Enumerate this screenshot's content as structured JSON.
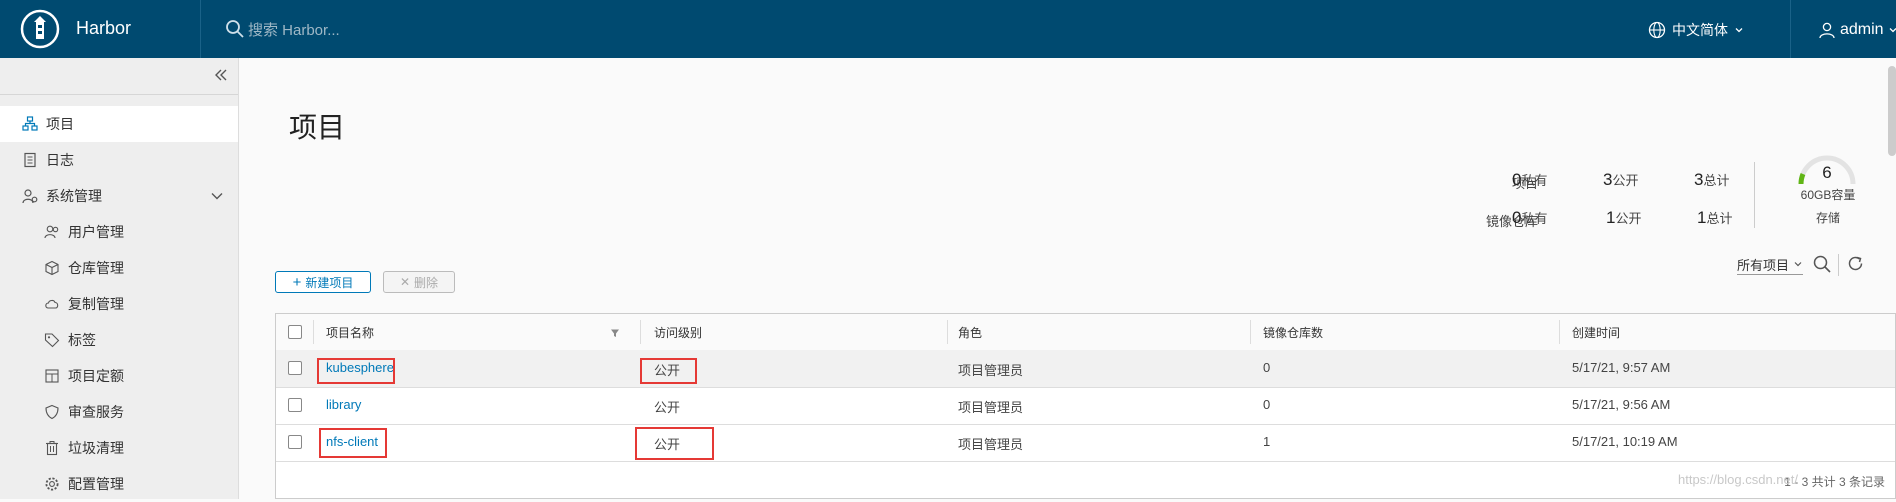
{
  "header": {
    "brand": "Harbor",
    "search_placeholder": "搜索 Harbor...",
    "language": "中文简体",
    "user": "admin"
  },
  "sidebar": {
    "items": [
      {
        "label": "项目",
        "icon": "projects-icon"
      },
      {
        "label": "日志",
        "icon": "log-icon"
      },
      {
        "label": "系统管理",
        "icon": "system-admin-icon"
      },
      {
        "label": "用户管理",
        "icon": "users-icon"
      },
      {
        "label": "仓库管理",
        "icon": "box-icon"
      },
      {
        "label": "复制管理",
        "icon": "cloud-sync-icon"
      },
      {
        "label": "标签",
        "icon": "tag-icon"
      },
      {
        "label": "项目定额",
        "icon": "quota-icon"
      },
      {
        "label": "审查服务",
        "icon": "shield-icon"
      },
      {
        "label": "垃圾清理",
        "icon": "trash-icon"
      },
      {
        "label": "配置管理",
        "icon": "gear-icon"
      }
    ]
  },
  "main": {
    "title": "项目",
    "stats": {
      "row1_label": "项目",
      "row2_label": "镜像仓库",
      "projects": {
        "private": "0",
        "public": "3",
        "total": "3"
      },
      "repos": {
        "private": "0",
        "public": "1",
        "total": "1"
      },
      "private_suffix": "私有",
      "public_suffix": "公开",
      "total_suffix": "总计"
    },
    "storage": {
      "count": "6",
      "capacity": "60GB容量",
      "label": "存储"
    },
    "toolbar": {
      "new_project": "新建项目",
      "delete": "删除",
      "filter": "所有项目"
    },
    "table": {
      "headers": [
        "项目名称",
        "访问级别",
        "角色",
        "镜像仓库数",
        "创建时间"
      ],
      "rows": [
        {
          "name": "kubesphere",
          "access": "公开",
          "role": "项目管理员",
          "repos": "0",
          "created": "5/17/21, 9:57 AM"
        },
        {
          "name": "library",
          "access": "公开",
          "role": "项目管理员",
          "repos": "0",
          "created": "5/17/21, 9:56 AM"
        },
        {
          "name": "nfs-client",
          "access": "公开",
          "role": "项目管理员",
          "repos": "1",
          "created": "5/17/21, 10:19 AM"
        }
      ],
      "footer": "1 - 3 共计 3 条记录"
    },
    "watermark": "https://blog.csdn.net/"
  },
  "colors": {
    "header_bg": "#004a70",
    "link": "#0079b8",
    "highlight": "#e53935"
  }
}
